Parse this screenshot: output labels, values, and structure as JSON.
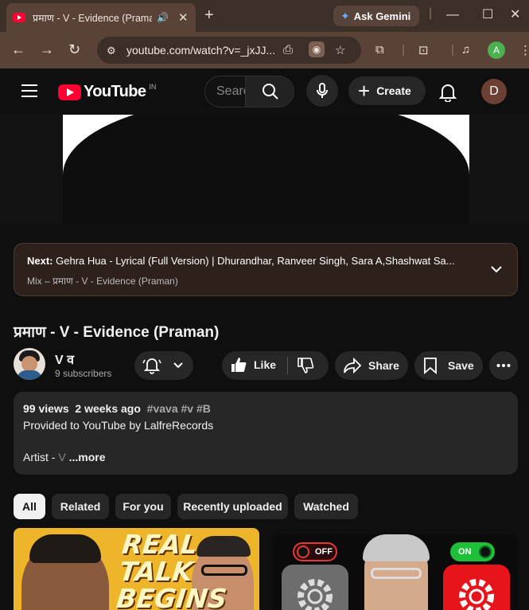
{
  "browser": {
    "tab_title": "प्रमाण - V - Evidence (Praman)",
    "gemini_label": "Ask Gemini",
    "url": "youtube.com/watch?v=_jxJJ...",
    "profile_initial": "A"
  },
  "youtube": {
    "logo_text": "YouTube",
    "country_code": "IN",
    "search_placeholder": "Search",
    "create_label": "Create",
    "avatar_initial": "D"
  },
  "next_up": {
    "prefix": "Next:",
    "title": "Gehra Hua - Lyrical (Full Version) | Dhurandhar, Ranveer Singh, Sara A,Shashwat Sa...",
    "mix": "Mix – प्रमाण - V - Evidence (Praman)"
  },
  "video": {
    "title": "प्रमाण - V - Evidence (Praman)",
    "channel_name": "V व",
    "subscribers": "9 subscribers",
    "like_label": "Like",
    "share_label": "Share",
    "save_label": "Save"
  },
  "description": {
    "views": "99 views",
    "date": "2 weeks ago",
    "tags": "#vava #v #B",
    "line": "Provided to YouTube by LalfreRecords",
    "artist_label": "Artist - ",
    "artist": "V",
    "more": " ...more"
  },
  "chips": [
    "All",
    "Related",
    "For you",
    "Recently uploaded",
    "Watched"
  ],
  "thumbnails": {
    "t1_line1": "REAL",
    "t1_line2": "TALK",
    "t1_line3": "BEGINS",
    "t2_off": "OFF",
    "t2_on": "ON"
  },
  "colors": {
    "accent_red": "#ff0033",
    "chrome_bg": "#5a4236",
    "page_bg": "#0f0f0f"
  }
}
